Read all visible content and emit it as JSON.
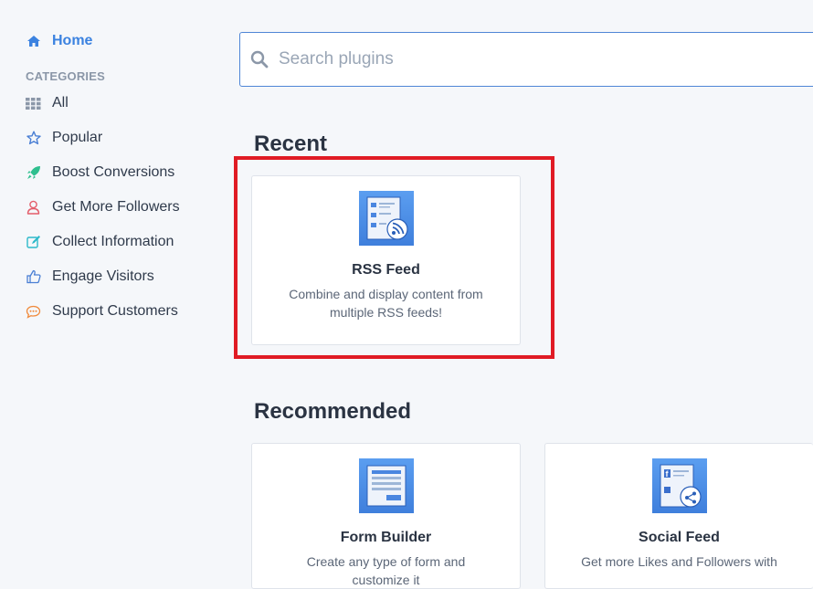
{
  "sidebar": {
    "home_label": "Home",
    "categories_heading": "CATEGORIES",
    "items": [
      {
        "label": "All",
        "icon": "grid-icon"
      },
      {
        "label": "Popular",
        "icon": "star-icon"
      },
      {
        "label": "Boost Conversions",
        "icon": "rocket-icon"
      },
      {
        "label": "Get More Followers",
        "icon": "user-icon"
      },
      {
        "label": "Collect Information",
        "icon": "edit-icon"
      },
      {
        "label": "Engage Visitors",
        "icon": "thumbs-up-icon"
      },
      {
        "label": "Support Customers",
        "icon": "chat-icon"
      }
    ]
  },
  "search": {
    "placeholder": "Search plugins"
  },
  "recent": {
    "title": "Recent",
    "cards": [
      {
        "title": "RSS Feed",
        "description": "Combine and display content from multiple RSS feeds!",
        "icon": "rss-feed-icon"
      }
    ]
  },
  "recommended": {
    "title": "Recommended",
    "cards": [
      {
        "title": "Form Builder",
        "description": "Create any type of form and customize it",
        "icon": "form-builder-icon"
      },
      {
        "title": "Social Feed",
        "description": "Get more Likes and Followers with",
        "icon": "social-feed-icon"
      }
    ]
  },
  "colors": {
    "accent": "#3b82e0",
    "highlight": "#e01b24",
    "background": "#f5f7fa"
  }
}
